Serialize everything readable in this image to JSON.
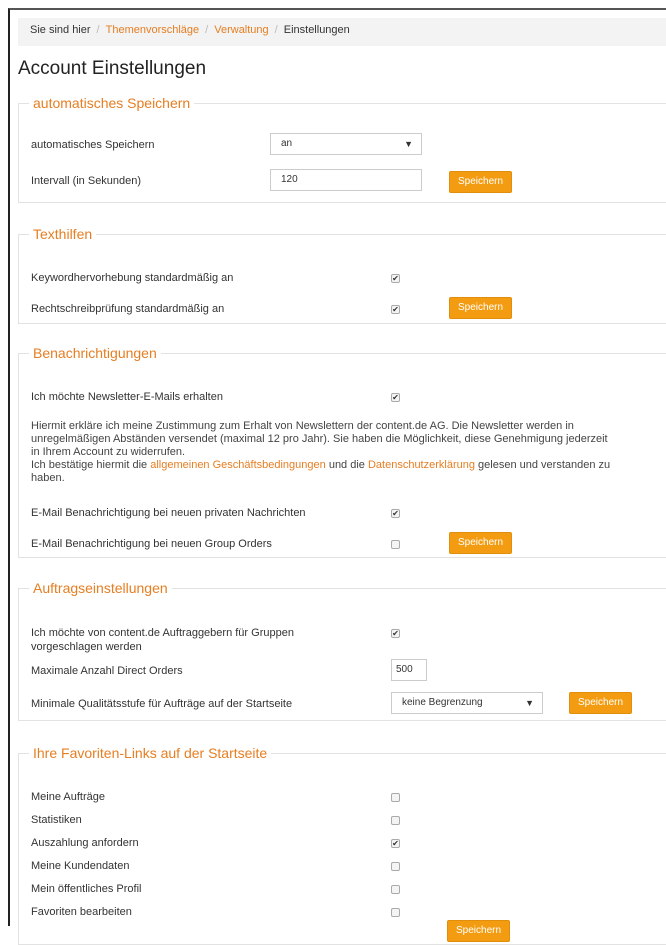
{
  "breadcrumb": {
    "prefix": "Sie sind hier",
    "crumb1": "Themenvorschläge",
    "crumb2": "Verwaltung",
    "current": "Einstellungen"
  },
  "page_title": "Account Einstellungen",
  "save_label": "Speichern",
  "autosave": {
    "legend": "automatisches Speichern",
    "label1": "automatisches Speichern",
    "select_value": "an",
    "label2": "Intervall (in Sekunden)",
    "interval_value": "120"
  },
  "texthilfen": {
    "legend": "Texthilfen",
    "label1": "Keywordhervorhebung standardmäßig an",
    "label2": "Rechtschreibprüfung standardmäßig an"
  },
  "benachrichtigungen": {
    "legend": "Benachrichtigungen",
    "label1": "Ich möchte Newsletter-E-Mails erhalten",
    "para1": "Hiermit erkläre ich meine Zustimmung zum Erhalt von Newslettern der content.de AG. Die Newsletter werden in unregelmäßigen Abständen versendet (maximal 12 pro Jahr). Sie haben die Möglichkeit, diese Genehmigung jederzeit in Ihrem Account zu widerrufen.",
    "para2_pre": "Ich bestätige hiermit die ",
    "agb_link": "allgemeinen Geschäftsbedingungen",
    "para2_mid": " und die ",
    "privacy_link": "Datenschutzerklärung",
    "para2_post": " gelesen und verstanden zu haben.",
    "label2": "E-Mail Benachrichtigung bei neuen privaten Nachrichten",
    "label3": "E-Mail Benachrichtigung bei neuen Group Orders"
  },
  "auftrag": {
    "legend": "Auftragseinstellungen",
    "label1": "Ich möchte von content.de Auftraggebern für Gruppen vorgeschlagen werden",
    "label2": "Maximale Anzahl Direct Orders",
    "max_value": "500",
    "label3": "Minimale Qualitätsstufe für Aufträge auf der Startseite",
    "quality_value": "keine Begrenzung"
  },
  "favoriten": {
    "legend": "Ihre Favoriten-Links auf der Startseite",
    "items": [
      "Meine Aufträge",
      "Statistiken",
      "Auszahlung anfordern",
      "Meine Kundendaten",
      "Mein öffentliches Profil",
      "Favoriten bearbeiten"
    ]
  },
  "checks": {
    "checked": "✔",
    "unchecked": ""
  }
}
